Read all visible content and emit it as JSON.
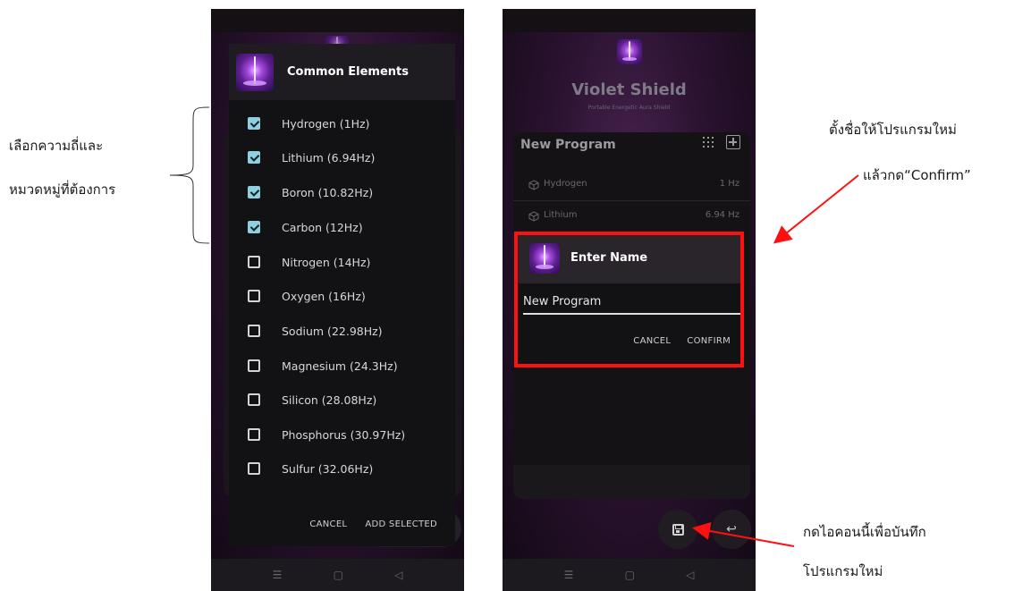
{
  "left_phone": {
    "dialog": {
      "title": "Common Elements",
      "items": [
        {
          "label": "Hydrogen (1Hz)",
          "checked": true
        },
        {
          "label": "Lithium (6.94Hz)",
          "checked": true
        },
        {
          "label": "Boron (10.82Hz)",
          "checked": true
        },
        {
          "label": "Carbon (12Hz)",
          "checked": true
        },
        {
          "label": "Nitrogen (14Hz)",
          "checked": false
        },
        {
          "label": "Oxygen (16Hz)",
          "checked": false
        },
        {
          "label": "Sodium (22.98Hz)",
          "checked": false
        },
        {
          "label": "Magnesium (24.3Hz)",
          "checked": false
        },
        {
          "label": "Silicon (28.08Hz)",
          "checked": false
        },
        {
          "label": "Phosphorus (30.97Hz)",
          "checked": false
        },
        {
          "label": "Sulfur (32.06Hz)",
          "checked": false
        }
      ],
      "cancel_label": "CANCEL",
      "add_label": "ADD SELECTED"
    }
  },
  "right_phone": {
    "app_title": "Violet Shield",
    "app_subtitle": "Portable Energetic Aura Shield",
    "program": {
      "title": "New Program",
      "items": [
        {
          "name": "Hydrogen",
          "freq": "1 Hz"
        },
        {
          "name": "Lithium",
          "freq": "6.94 Hz"
        }
      ]
    },
    "name_dialog": {
      "title": "Enter Name",
      "value": "New Program",
      "cancel_label": "CANCEL",
      "confirm_label": "CONFIRM"
    }
  },
  "nav_icons": [
    "menu-icon",
    "home-square-icon",
    "back-triangle-icon"
  ],
  "annotations": {
    "left_line1": "เลือกความถี่และ",
    "left_line2": "หมวดหมู่ที่ต้องการ",
    "right_top_line1": "ตั้งชื่อให้โปรแกรมใหม่",
    "right_top_line2": "แล้วกด“Confirm”",
    "right_bottom_line1": "กดไอคอนนี้เพื่อบันทึก",
    "right_bottom_line2": "โปรแกรมใหม่"
  },
  "colors": {
    "highlight": "#ff1010",
    "checkbox_checked": "#8fd0e0",
    "phone_bg": "#2a1230"
  }
}
